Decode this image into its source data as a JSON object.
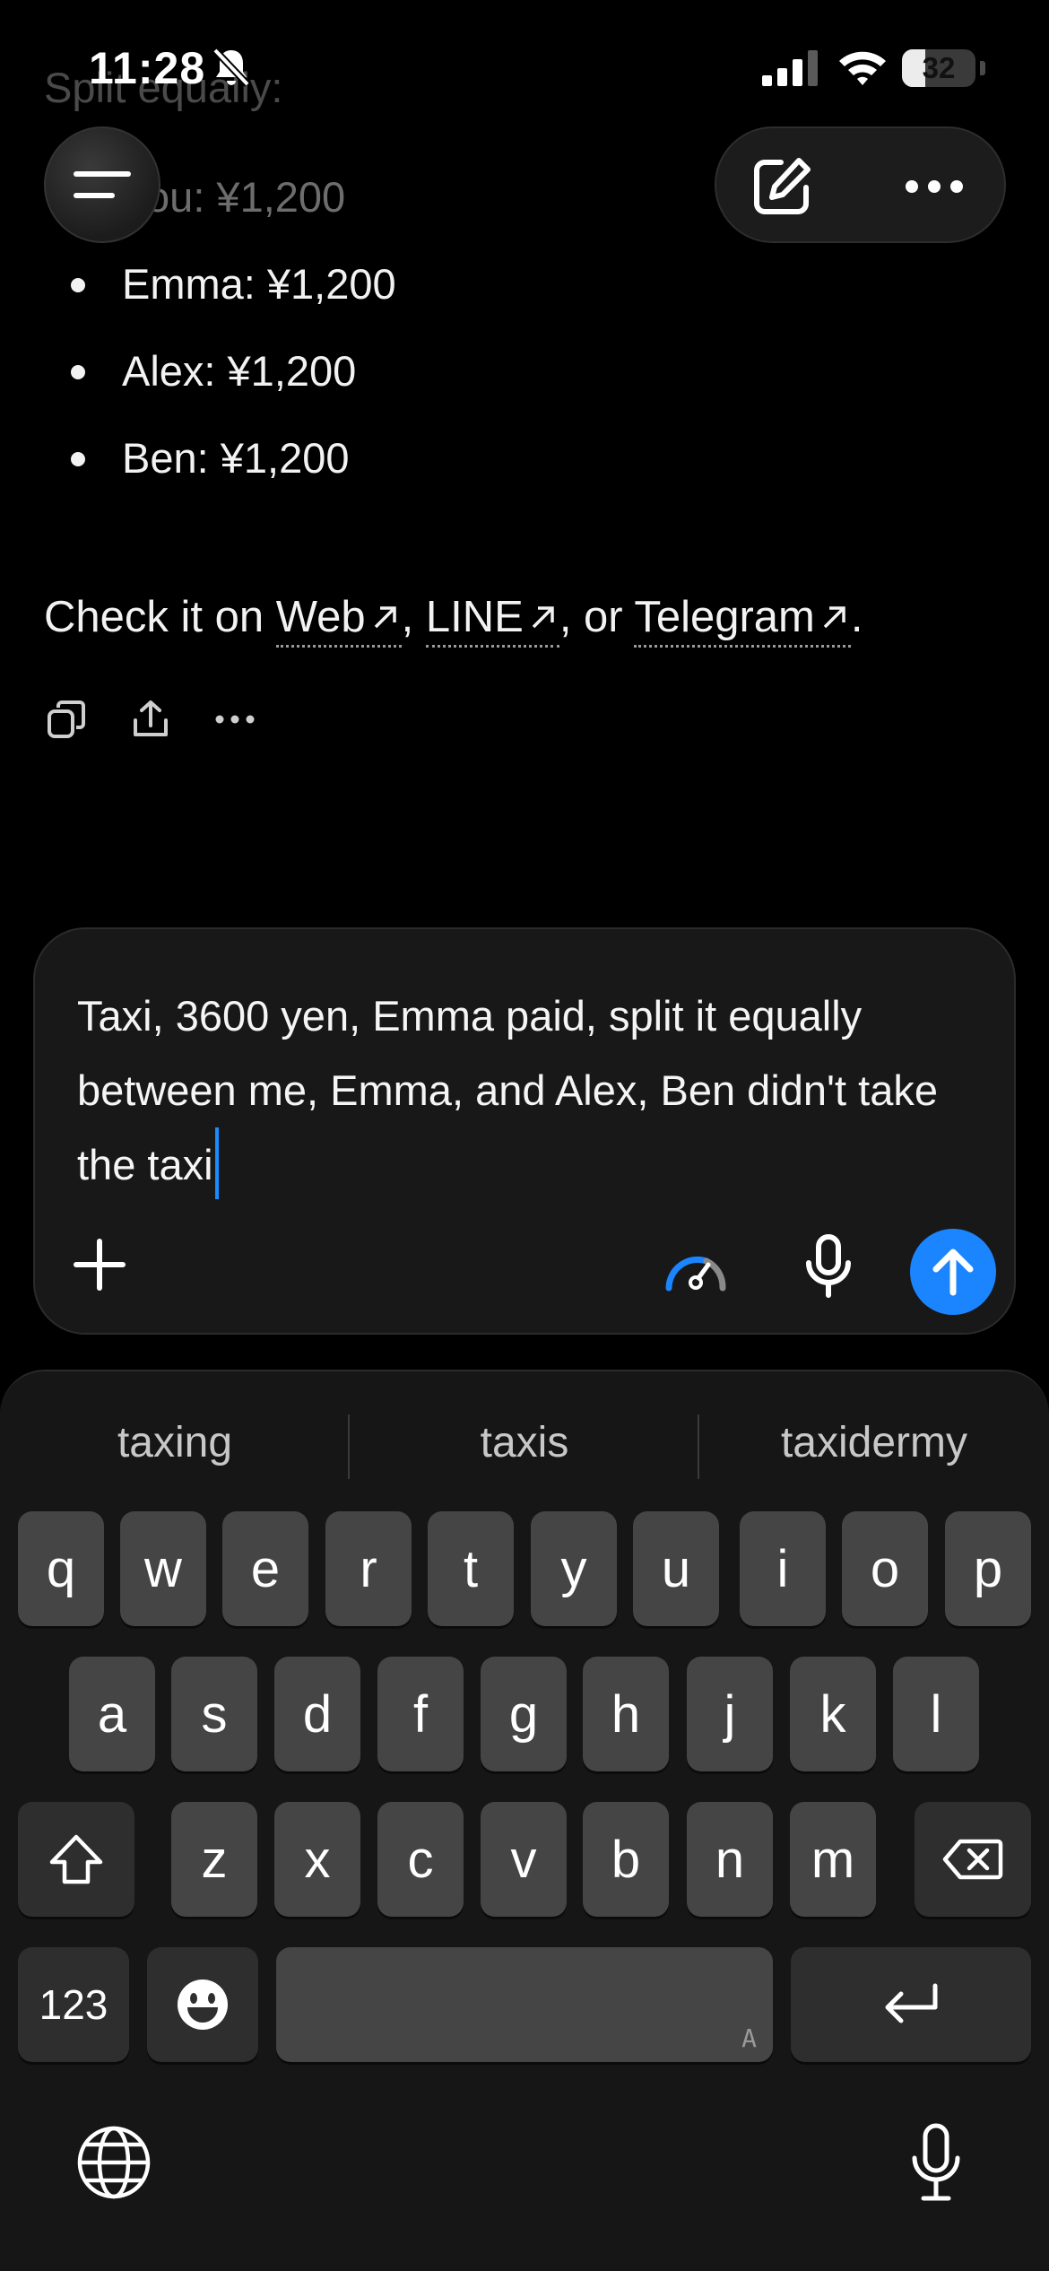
{
  "status_bar": {
    "time": "11:28",
    "battery": "32",
    "battery_percent": 32
  },
  "chat": {
    "split_title": "Split equally:",
    "bullets": [
      "You: ¥1,200",
      "Emma: ¥1,200",
      "Alex: ¥1,200",
      "Ben: ¥1,200"
    ],
    "check_prefix": "Check it on",
    "link_web": "Web",
    "sep1": ",",
    "link_line": "LINE",
    "sep2": ", or",
    "link_telegram": "Telegram",
    "suffix": "."
  },
  "composer": {
    "text": "Taxi, 3600 yen, Emma paid, split it equally between me, Emma, and Alex, Ben didn't take the taxi"
  },
  "keyboard": {
    "suggestions": [
      "taxing",
      "taxis",
      "taxidermy"
    ],
    "row1": [
      "q",
      "w",
      "e",
      "r",
      "t",
      "y",
      "u",
      "i",
      "o",
      "p"
    ],
    "row2": [
      "a",
      "s",
      "d",
      "f",
      "g",
      "h",
      "j",
      "k",
      "l"
    ],
    "row3": [
      "z",
      "x",
      "c",
      "v",
      "b",
      "n",
      "m"
    ],
    "numbers_key": "123",
    "space_hint": "A"
  },
  "colors": {
    "accent": "#1a85ff",
    "background": "#000000",
    "key": "#454545"
  }
}
